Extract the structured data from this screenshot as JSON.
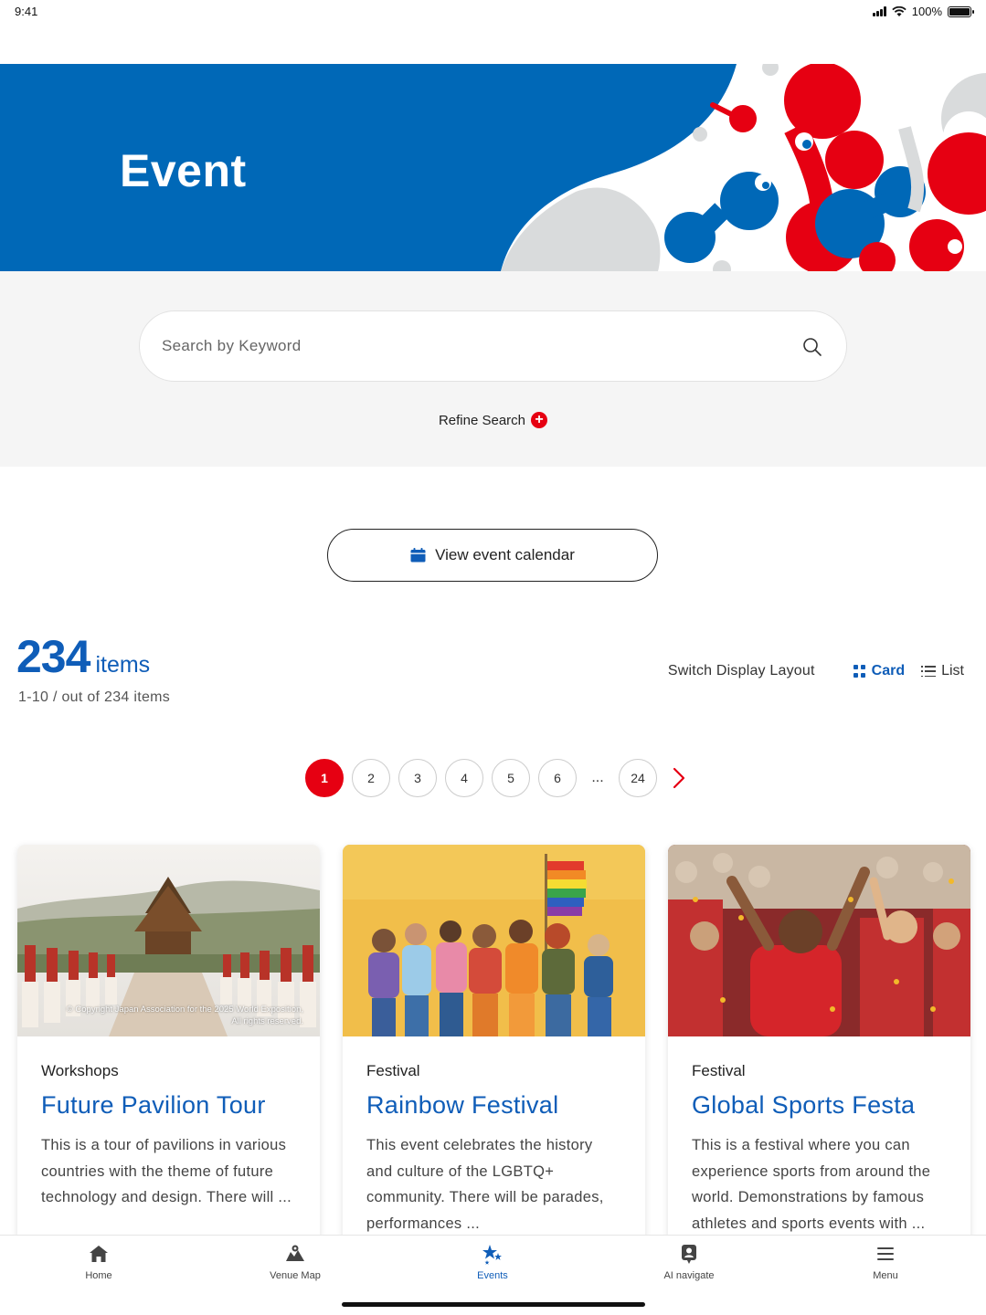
{
  "status_bar": {
    "time": "9:41",
    "battery": "100%"
  },
  "hero": {
    "title": "Event"
  },
  "search": {
    "placeholder": "Search by Keyword",
    "refine_label": "Refine Search"
  },
  "calendar_button": {
    "label": "View event calendar"
  },
  "results": {
    "count": "234",
    "count_unit": "items",
    "range_text": "1-10 / out of 234 items"
  },
  "layout_switch": {
    "label": "Switch Display Layout",
    "options": [
      {
        "label": "Card",
        "active": true,
        "icon": "grid-icon"
      },
      {
        "label": "List",
        "active": false,
        "icon": "list-icon"
      }
    ]
  },
  "pagination": {
    "pages": [
      "1",
      "2",
      "3",
      "4",
      "5",
      "6"
    ],
    "ellipsis": "...",
    "last_page": "24",
    "current": "1"
  },
  "cards": [
    {
      "category": "Workshops",
      "title": "Future Pavilion Tour",
      "description": "This is a tour of pavilions in various countries with the theme of future technology and design. There will ...",
      "image": "temple-garden-photo",
      "copyright_line1": "© Copyright Japan Association for the 2025 World Exposition,",
      "copyright_line2": "All rights reserved."
    },
    {
      "category": "Festival",
      "title": "Rainbow Festival",
      "description": "This event celebrates the history and culture of the LGBTQ+ community. There will be parades, performances ...",
      "image": "group-with-rainbow-flag-photo"
    },
    {
      "category": "Festival",
      "title": "Global Sports Festa",
      "description": "This is a festival where you can experience sports from around the world. Demonstrations by famous athletes and sports events with ...",
      "image": "cheering-crowd-photo"
    }
  ],
  "tabbar": {
    "items": [
      {
        "label": "Home",
        "icon": "home-icon",
        "active": false
      },
      {
        "label": "Venue Map",
        "icon": "map-icon",
        "active": false
      },
      {
        "label": "Events",
        "icon": "events-icon",
        "active": true
      },
      {
        "label": "AI navigate",
        "icon": "ai-navigate-icon",
        "active": false
      },
      {
        "label": "Menu",
        "icon": "menu-icon",
        "active": false
      }
    ]
  },
  "colors": {
    "brand_blue": "#0f5db8",
    "accent_red": "#e60012",
    "hero_blue": "#0068b7"
  }
}
